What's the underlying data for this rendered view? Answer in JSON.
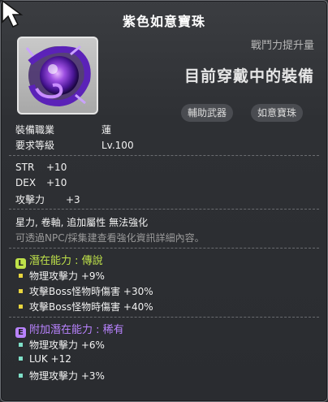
{
  "title": "紫色如意寶珠",
  "power_label": "戰鬥力提升量",
  "equipped_label": "目前穿戴中的裝備",
  "tags": [
    "輔助武器",
    "如意寶珠"
  ],
  "basic": [
    {
      "key": "裝備職業",
      "value": "蓮"
    },
    {
      "key": "要求等級",
      "value": "Lv.100"
    }
  ],
  "stats": [
    {
      "key": "STR",
      "value": "+10"
    },
    {
      "key": "DEX",
      "value": "+10"
    },
    {
      "key": "攻擊力",
      "value": "+3"
    }
  ],
  "notes": {
    "restrictions": "星力, 卷軸, 追加屬性 無法強化",
    "hint": "可透過NPC/採集建查看強化資訊詳細內容。"
  },
  "potential": {
    "badge": "L",
    "title": "潛在能力 : 傳說",
    "color": "#bfe24a",
    "lines": [
      "物理攻擊力 +9%",
      "攻擊Boss怪物時傷害 +30%",
      "攻擊Boss怪物時傷害 +40%"
    ],
    "dot_color": "#e8d53e"
  },
  "additional": {
    "badge": "E",
    "title": "附加潛在能力 : 稀有",
    "color": "#b983ff",
    "lines": [
      "物理攻擊力 +6%",
      "LUK +12",
      "物理攻擊力 +3%"
    ],
    "dot_color": "#7fe0c8"
  }
}
